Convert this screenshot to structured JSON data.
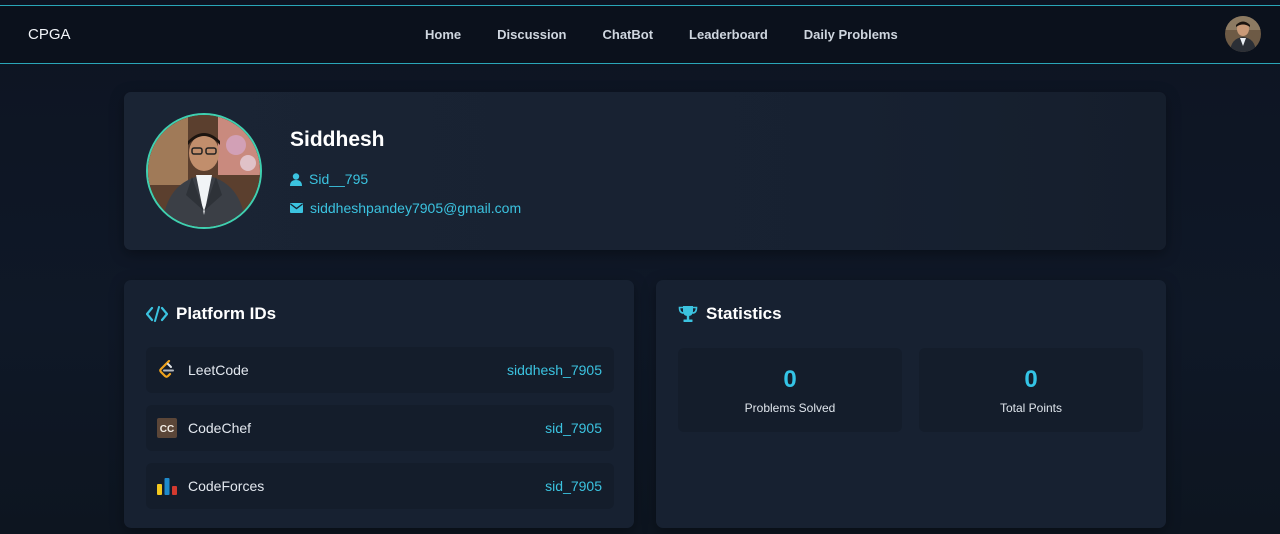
{
  "navbar": {
    "brand": "CPGA",
    "links": [
      "Home",
      "Discussion",
      "ChatBot",
      "Leaderboard",
      "Daily Problems"
    ]
  },
  "profile": {
    "name": "Siddhesh",
    "username": "Sid__795",
    "email": "siddheshpandey7905@gmail.com"
  },
  "platforms": {
    "title": "Platform IDs",
    "items": [
      {
        "name": "LeetCode",
        "id": "siddhesh_7905",
        "icon": "leetcode-icon"
      },
      {
        "name": "CodeChef",
        "id": "sid_7905",
        "icon": "codechef-icon"
      },
      {
        "name": "CodeForces",
        "id": "sid_7905",
        "icon": "codeforces-icon"
      }
    ]
  },
  "statistics": {
    "title": "Statistics",
    "problems_solved": "0",
    "problems_solved_label": "Problems Solved",
    "total_points": "0",
    "total_points_label": "Total Points"
  },
  "colors": {
    "accent": "#3bc3e0",
    "avatar_ring": "#3fd0b0",
    "card_bg": "#172131",
    "page_bg": "#0f1827"
  }
}
